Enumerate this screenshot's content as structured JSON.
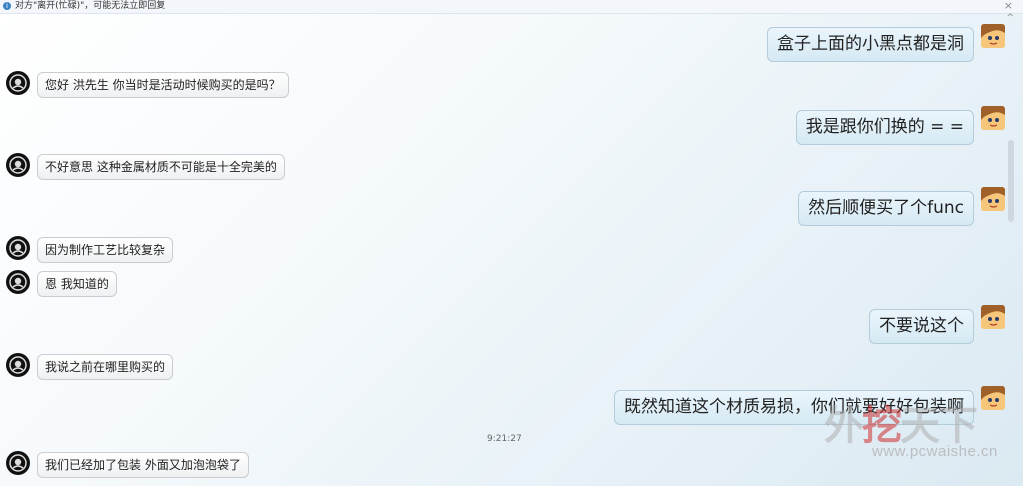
{
  "status_bar": {
    "message": "对方\"离开(忙碌)\"，可能无法立即回复",
    "close_glyph": "×",
    "collapse_glyph": "^"
  },
  "messages": {
    "other": [
      "您好 洪先生 你当时是活动时候购买的是吗？",
      "不好意思 这种金属材质不可能是十全完美的",
      "因为制作工艺比较复杂",
      "恩 我知道的",
      "我说之前在哪里购买的",
      "我们已经加了包装 外面又加泡泡袋了"
    ],
    "me": [
      "盒子上面的小黑点都是洞",
      "我是跟你们换的 = =",
      "然后顺便买了个func",
      "不要说这个",
      "既然知道这个材质易损，你们就要好好包装啊"
    ]
  },
  "timestamp": "9:21:27",
  "watermark": {
    "logo_grey": "外",
    "logo_red": "挖",
    "logo_rest": "天下",
    "url": "www.pcwaishe.cn"
  },
  "colors": {
    "bubble_other": "#f3f4f5",
    "bubble_me": "#dcedf6",
    "avatar_other": "#111111",
    "avatar_me": "#f6c77a"
  }
}
